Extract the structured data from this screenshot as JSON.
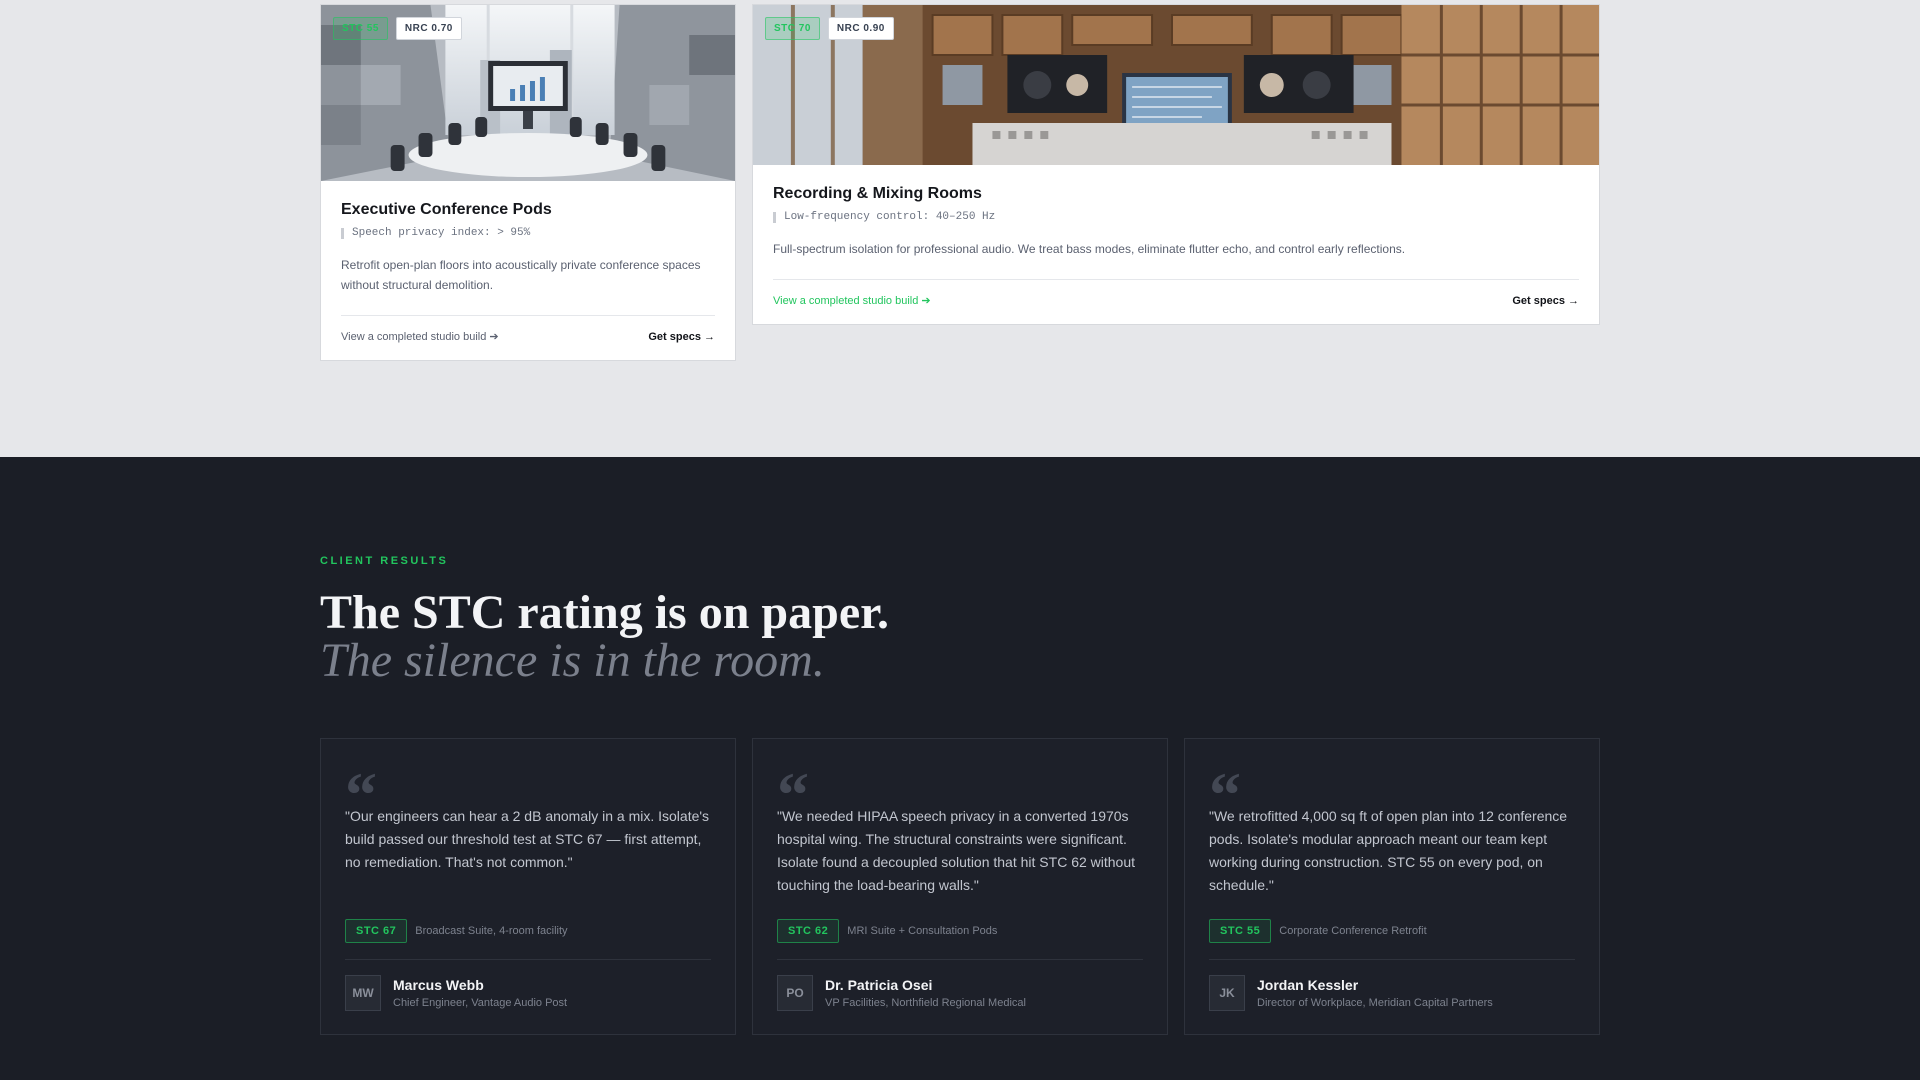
{
  "cards": [
    {
      "stc_tag": "STC 55",
      "nrc_tag": "NRC 0.70",
      "title": "Executive Conference Pods",
      "spec": "Speech privacy index: > 95%",
      "description": "Retrofit open-plan floors into acoustically private conference spaces without structural demolition.",
      "link": "View a completed studio build",
      "cta": "Get specs →"
    },
    {
      "stc_tag": "STC 70",
      "nrc_tag": "NRC 0.90",
      "title": "Recording & Mixing Rooms",
      "spec": "Low-frequency control: 40–250 Hz",
      "description": "Full-spectrum isolation for professional audio. We treat bass modes, eliminate flutter echo, and control early reflections.",
      "link": "View a completed studio build",
      "cta": "Get specs →"
    }
  ],
  "results": {
    "eyebrow": "CLIENT RESULTS",
    "headline": "The STC rating is on paper.",
    "headline_sub": "The silence is in the room.",
    "testimonials": [
      {
        "quote": "\"Our engineers can hear a 2 dB anomaly in a mix. Isolate's build passed our threshold test at STC 67 — first attempt, no remediation. That's not common.\"",
        "badge": "STC 67",
        "project": "Broadcast Suite, 4-room facility",
        "initials": "MW",
        "name": "Marcus Webb",
        "role": "Chief Engineer, Vantage Audio Post"
      },
      {
        "quote": "\"We needed HIPAA speech privacy in a converted 1970s hospital wing. The structural constraints were significant. Isolate found a decoupled solution that hit STC 62 without touching the load-bearing walls.\"",
        "badge": "STC 62",
        "project": "MRI Suite + Consultation Pods",
        "initials": "PO",
        "name": "Dr. Patricia Osei",
        "role": "VP Facilities, Northfield Regional Medical"
      },
      {
        "quote": "\"We retrofitted 4,000 sq ft of open plan into 12 conference pods. Isolate's modular approach meant our team kept working during construction. STC 55 on every pod, on schedule.\"",
        "badge": "STC 55",
        "project": "Corporate Conference Retrofit",
        "initials": "JK",
        "name": "Jordan Kessler",
        "role": "Director of Workplace, Meridian Capital Partners"
      }
    ]
  },
  "colors": {
    "accent": "#22c55e",
    "dark_bg": "#1b1e26",
    "light_bg": "#e6e7ea"
  },
  "icons": {
    "quote": "quote-icon",
    "arrow": "arrow-right-icon"
  }
}
